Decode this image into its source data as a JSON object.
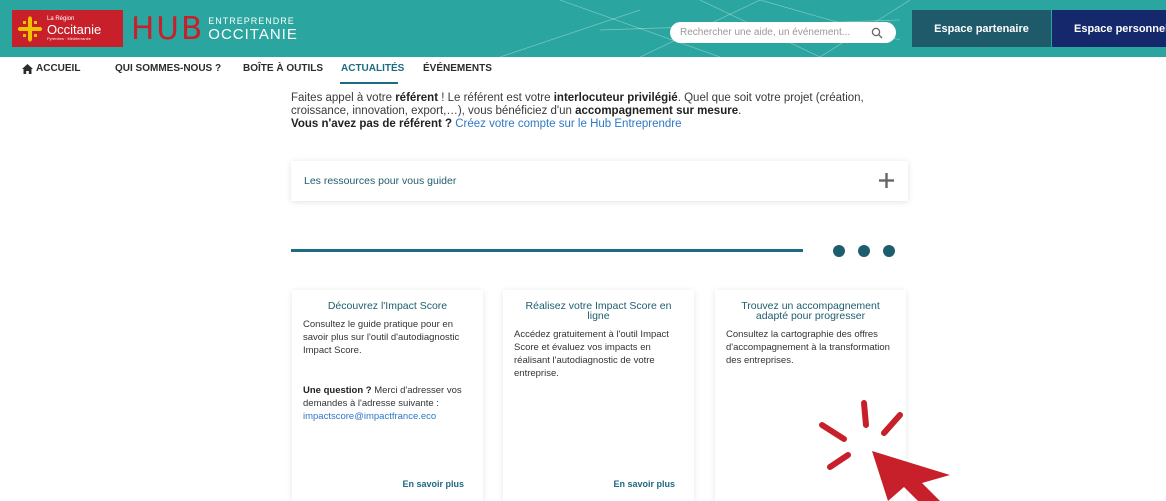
{
  "header": {
    "region_logo": {
      "small": "La Région",
      "name": "Occitanie",
      "sub": "Pyrénées · Méditerranée"
    },
    "hub_logo": {
      "word": "HUB",
      "top": "ENTREPRENDRE",
      "bottom": "OCCITANIE"
    },
    "search": {
      "placeholder": "Rechercher une aide, un événement...",
      "icon": "search-icon"
    },
    "partner_button": "Espace partenaire",
    "personal_button": "Espace personnel",
    "colors": {
      "header_bg": "#2aa59f",
      "red": "#c8202b",
      "partner": "#1f5a6a",
      "personal": "#14286b"
    }
  },
  "nav": {
    "items": [
      {
        "label": "ACCUEIL",
        "icon": "home-icon"
      },
      {
        "label": "QUI SOMMES-NOUS ?"
      },
      {
        "label": "BOÎTE À OUTILS"
      },
      {
        "label": "ACTUALITÉS",
        "active": true
      },
      {
        "label": "ÉVÉNEMENTS"
      }
    ]
  },
  "intro": {
    "p1_a": "Faites appel à votre ",
    "p1_b": "référent",
    "p1_c": " ! Le référent est votre ",
    "p1_d": "interlocuteur privilégié",
    "p1_e": ". Quel que soit votre projet (création, croissance, innovation, export,…), vous bénéficiez d'un ",
    "p1_f": "accompagnement sur mesure",
    "p1_g": ".",
    "p2_a": "Vous n'avez pas de référent ?",
    "p2_link": " Créez votre compte sur le Hub Entreprendre"
  },
  "accordion": {
    "label": "Les ressources pour vous guider",
    "icon": "plus-icon"
  },
  "cards": [
    {
      "title": "Découvrez l'Impact Score",
      "body": "Consultez le guide pratique pour en savoir plus sur l'outil d'autodiagnostic Impact Score.",
      "question_bold": "Une question ?",
      "question_text": " Merci d'adresser vos demandes à l'adresse suivante :",
      "email": "impactscore@impactfrance.eco",
      "more": "En savoir plus"
    },
    {
      "title": "Réalisez votre Impact Score en ligne",
      "body": "Accédez gratuitement à l'outil Impact Score et évaluez vos impacts en réalisant l'autodiagnostic de votre entreprise.",
      "more": "En savoir plus"
    },
    {
      "title": "Trouvez un accompagnement adapté pour progresser",
      "body": "Consultez la cartographie des offres d'accompagnement à la transformation des entreprises.",
      "more": ""
    }
  ]
}
